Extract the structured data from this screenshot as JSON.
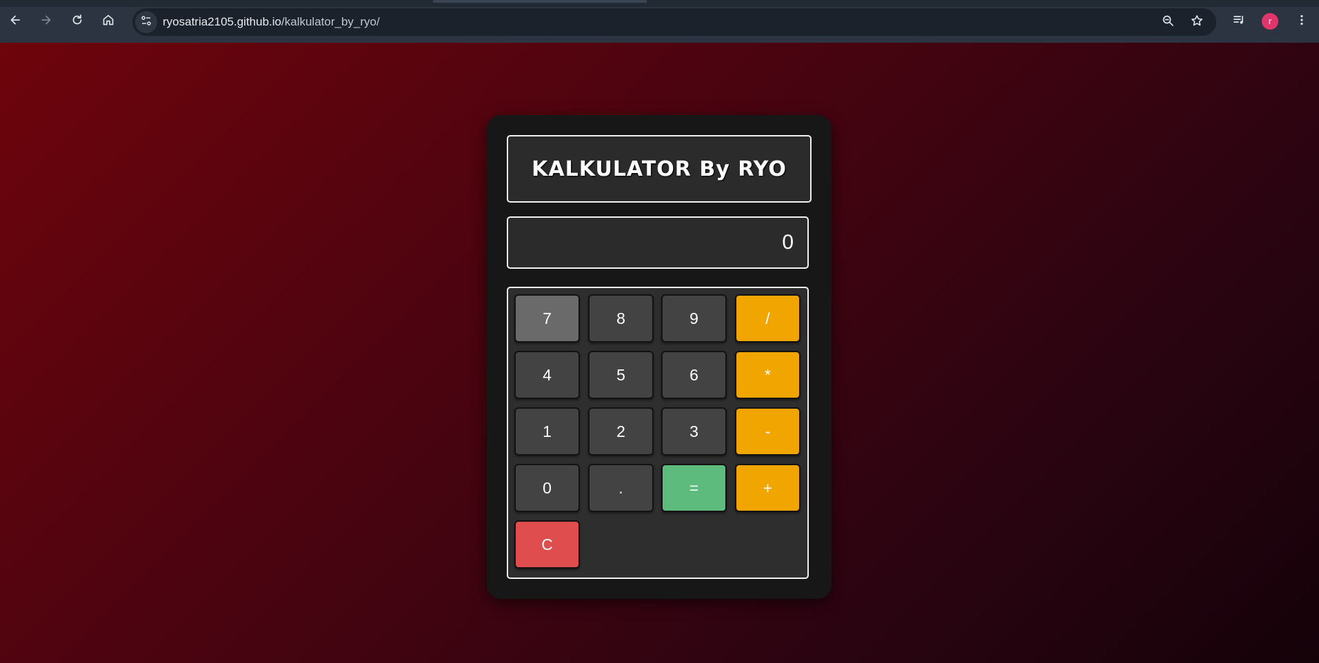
{
  "browser": {
    "url_host": "ryosatria2105.github.io",
    "url_path": "/kalkulator_by_ryo/",
    "profile_initial": "r",
    "profile_color": "#e0366d",
    "icons": [
      "back-arrow-icon",
      "forward-arrow-icon",
      "reload-icon",
      "home-icon",
      "site-info-icon",
      "zoom-icon",
      "bookmark-star-icon",
      "media-control-icon",
      "menu-dots-icon"
    ]
  },
  "calculator": {
    "title": "KALKULATOR By RYO",
    "display_value": "0",
    "keys": {
      "k7": "7",
      "k8": "8",
      "k9": "9",
      "div": "/",
      "k4": "4",
      "k5": "5",
      "k6": "6",
      "mul": "*",
      "k1": "1",
      "k2": "2",
      "k3": "3",
      "sub": "-",
      "k0": "0",
      "dot": ".",
      "eq": "=",
      "add": "+",
      "clear": "C"
    },
    "colors": {
      "number_key": "#434343",
      "operator_key": "#f0a500",
      "equals_key": "#5dbb7e",
      "clear_key": "#e04d4f"
    }
  }
}
